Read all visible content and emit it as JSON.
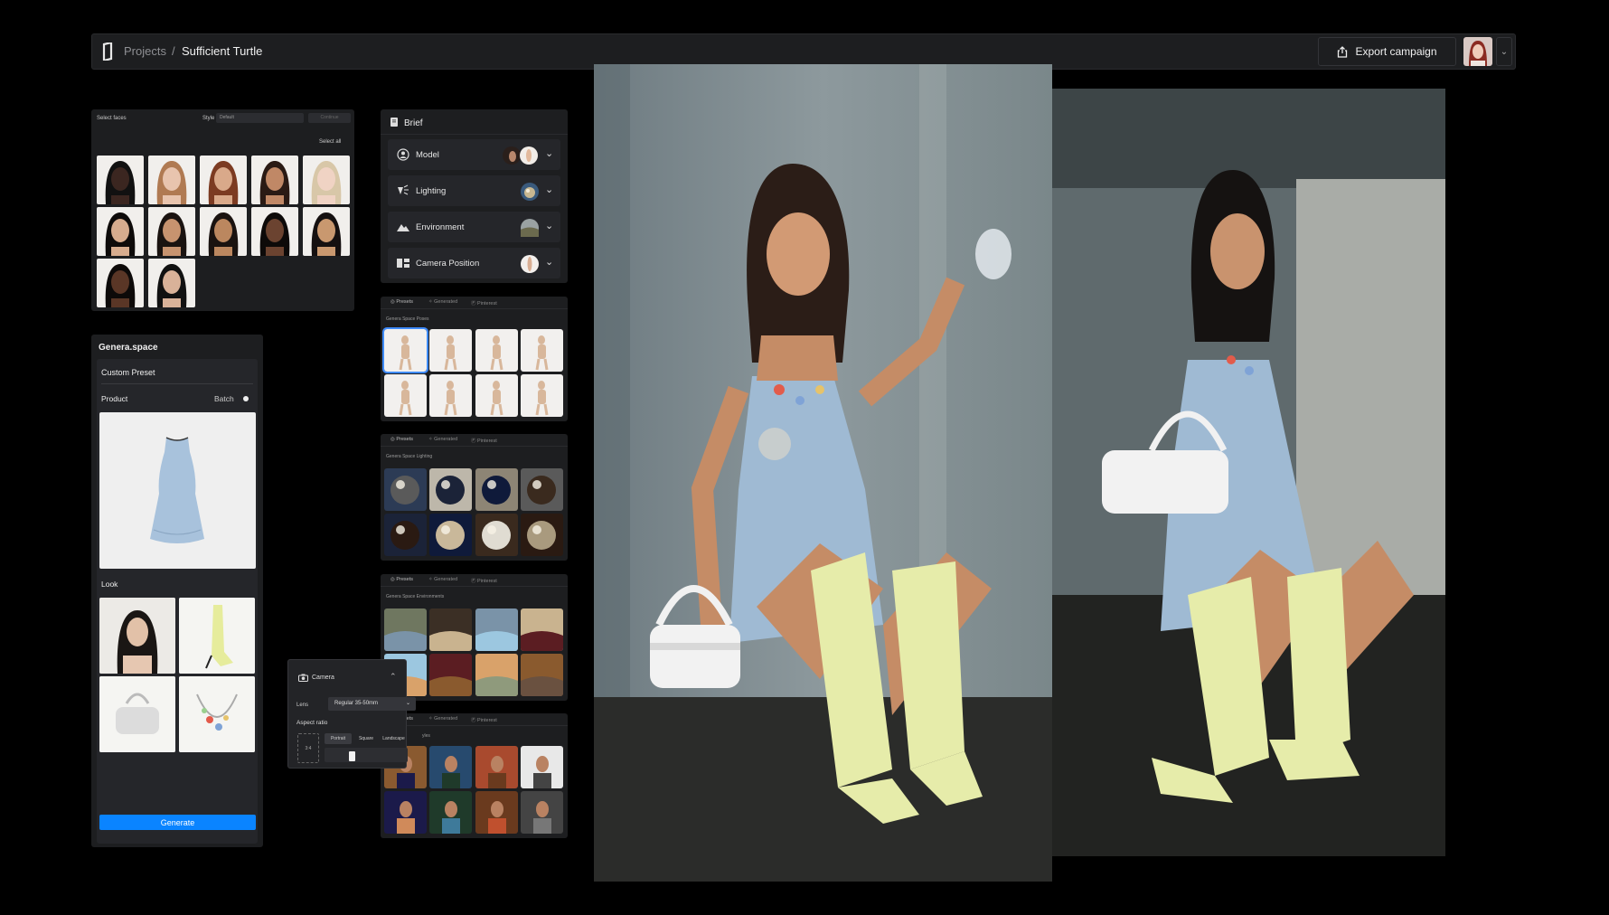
{
  "header": {
    "breadcrumb_root": "Projects",
    "breadcrumb_sep": "/",
    "breadcrumb_current": "Sufficient Turtle",
    "export_label": "Export campaign"
  },
  "faces_panel": {
    "title": "Select faces",
    "style_label": "Style",
    "style_value": "Default",
    "continue_label": "Continue",
    "select_all": "Select all"
  },
  "brief": {
    "title": "Brief",
    "rows": [
      {
        "label": "Model"
      },
      {
        "label": "Lighting"
      },
      {
        "label": "Environment"
      },
      {
        "label": "Camera Position"
      }
    ]
  },
  "presets": {
    "tab_presets": "Presets",
    "tab_generated": "Generated",
    "tab_pinterest": "Pinterest",
    "poses_title": "Genera Space Poses",
    "lighting_title": "Genera Space Lighting",
    "environments_title": "Genera Space Environments",
    "styles_title_partial": "yles"
  },
  "genera": {
    "brand": "Genera.space",
    "custom_preset": "Custom Preset",
    "product_label": "Product",
    "batch_label": "Batch",
    "look_label": "Look",
    "generate_label": "Generate"
  },
  "camera": {
    "title": "Camera",
    "lens_label": "Lens",
    "lens_value": "Regular 35-50mm",
    "aspect_label": "Aspect ratio",
    "aspect_value": "3:4",
    "aspect_options": [
      "Portrait",
      "Square",
      "Landscape"
    ]
  },
  "colors": {
    "accent": "#0a84ff",
    "panel": "#1d1e20",
    "background": "#000000"
  }
}
